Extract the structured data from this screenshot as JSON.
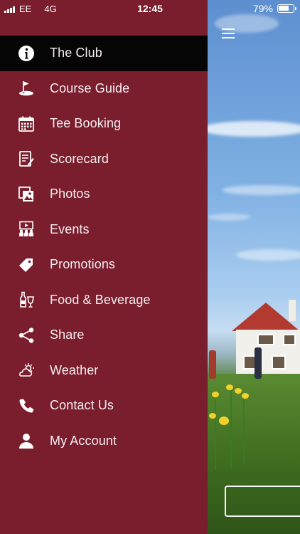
{
  "status_bar": {
    "carrier": "EE",
    "network": "4G",
    "time": "12:45",
    "battery": "79%",
    "battery_level": 0.79
  },
  "menu": {
    "items": [
      {
        "label": "The Club",
        "icon": "info-icon",
        "active": true
      },
      {
        "label": "Course Guide",
        "icon": "golf-flag-icon",
        "active": false
      },
      {
        "label": "Tee Booking",
        "icon": "calendar-icon",
        "active": false
      },
      {
        "label": "Scorecard",
        "icon": "scorecard-icon",
        "active": false
      },
      {
        "label": "Photos",
        "icon": "photos-icon",
        "active": false
      },
      {
        "label": "Events",
        "icon": "events-icon",
        "active": false
      },
      {
        "label": "Promotions",
        "icon": "tag-icon",
        "active": false
      },
      {
        "label": "Food & Beverage",
        "icon": "food-beverage-icon",
        "active": false
      },
      {
        "label": "Share",
        "icon": "share-icon",
        "active": false
      },
      {
        "label": "Weather",
        "icon": "weather-icon",
        "active": false
      },
      {
        "label": "Contact Us",
        "icon": "phone-icon",
        "active": false
      },
      {
        "label": "My Account",
        "icon": "user-icon",
        "active": false
      }
    ]
  },
  "colors": {
    "sidebar_bg": "#7a1e2e",
    "active_bg": "#050505",
    "text": "#ffffff"
  }
}
